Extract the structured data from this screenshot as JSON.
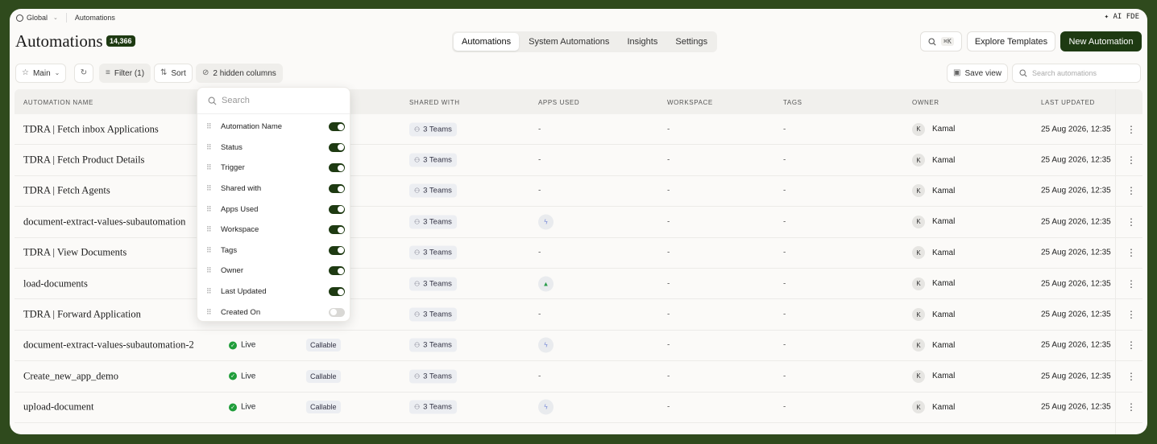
{
  "topbar": {
    "workspace": "Global",
    "breadcrumb": "Automations",
    "ai_label": "✦ AI FDE"
  },
  "header": {
    "title": "Automations",
    "count": "14,366",
    "tabs": [
      "Automations",
      "System Automations",
      "Insights",
      "Settings"
    ],
    "active_tab": "Automations",
    "search_shortcut": "⌘K",
    "explore_label": "Explore Templates",
    "new_label": "New Automation"
  },
  "toolbar": {
    "view_label": "Main",
    "filter_label": "Filter (1)",
    "sort_label": "Sort",
    "hidden_columns_label": "2 hidden columns",
    "save_view_label": "Save view",
    "search_placeholder": "Search automations"
  },
  "columns": [
    "AUTOMATION NAME",
    "SHARED WITH",
    "APPS USED",
    "WORKSPACE",
    "TAGS",
    "OWNER",
    "LAST UPDATED"
  ],
  "rows": [
    {
      "name": "TDRA | Fetch inbox Applications",
      "status": "",
      "trigger": "",
      "shared": "3 Teams",
      "apps": "-",
      "workspace": "-",
      "tags": "-",
      "owner_initial": "K",
      "owner": "Kamal",
      "updated": "25 Aug 2026, 12:35"
    },
    {
      "name": "TDRA | Fetch Product Details",
      "status": "",
      "trigger": "",
      "shared": "3 Teams",
      "apps": "-",
      "workspace": "-",
      "tags": "-",
      "owner_initial": "K",
      "owner": "Kamal",
      "updated": "25 Aug 2026, 12:35"
    },
    {
      "name": "TDRA | Fetch Agents",
      "status": "",
      "trigger": "",
      "shared": "3 Teams",
      "apps": "-",
      "workspace": "-",
      "tags": "-",
      "owner_initial": "K",
      "owner": "Kamal",
      "updated": "25 Aug 2026, 12:35"
    },
    {
      "name": "document-extract-values-subautomation",
      "status": "",
      "trigger": "",
      "shared": "3 Teams",
      "apps": "app-icon",
      "workspace": "-",
      "tags": "-",
      "owner_initial": "K",
      "owner": "Kamal",
      "updated": "25 Aug 2026, 12:35"
    },
    {
      "name": "TDRA | View Documents",
      "status": "",
      "trigger": "",
      "shared": "3 Teams",
      "apps": "-",
      "workspace": "-",
      "tags": "-",
      "owner_initial": "K",
      "owner": "Kamal",
      "updated": "25 Aug 2026, 12:35"
    },
    {
      "name": "load-documents",
      "status": "",
      "trigger": "",
      "shared": "3 Teams",
      "apps": "drive-icon",
      "workspace": "-",
      "tags": "-",
      "owner_initial": "K",
      "owner": "Kamal",
      "updated": "25 Aug 2026, 12:35"
    },
    {
      "name": "TDRA | Forward Application",
      "status": "",
      "trigger": "",
      "shared": "3 Teams",
      "apps": "-",
      "workspace": "-",
      "tags": "-",
      "owner_initial": "K",
      "owner": "Kamal",
      "updated": "25 Aug 2026, 12:35"
    },
    {
      "name": "document-extract-values-subautomation-2",
      "status": "Live",
      "trigger": "Callable",
      "shared": "3 Teams",
      "apps": "app-icon",
      "workspace": "-",
      "tags": "-",
      "owner_initial": "K",
      "owner": "Kamal",
      "updated": "25 Aug 2026, 12:35"
    },
    {
      "name": "Create_new_app_demo",
      "status": "Live",
      "trigger": "Callable",
      "shared": "3 Teams",
      "apps": "-",
      "workspace": "-",
      "tags": "-",
      "owner_initial": "K",
      "owner": "Kamal",
      "updated": "25 Aug 2026, 12:35"
    },
    {
      "name": "upload-document",
      "status": "Live",
      "trigger": "Callable",
      "shared": "3 Teams",
      "apps": "app-icon",
      "workspace": "-",
      "tags": "-",
      "owner_initial": "K",
      "owner": "Kamal",
      "updated": "25 Aug 2026, 12:35"
    }
  ],
  "popover": {
    "search_placeholder": "Search",
    "items": [
      {
        "label": "Automation Name",
        "on": true
      },
      {
        "label": "Status",
        "on": true
      },
      {
        "label": "Trigger",
        "on": true
      },
      {
        "label": "Shared with",
        "on": true
      },
      {
        "label": "Apps Used",
        "on": true
      },
      {
        "label": "Workspace",
        "on": true
      },
      {
        "label": "Tags",
        "on": true
      },
      {
        "label": "Owner",
        "on": true
      },
      {
        "label": "Last Updated",
        "on": true
      },
      {
        "label": "Created On",
        "on": false
      }
    ]
  },
  "colors": {
    "brand": "#1e3a12",
    "live": "#1f9d3a",
    "background": "#2f4a1d"
  }
}
